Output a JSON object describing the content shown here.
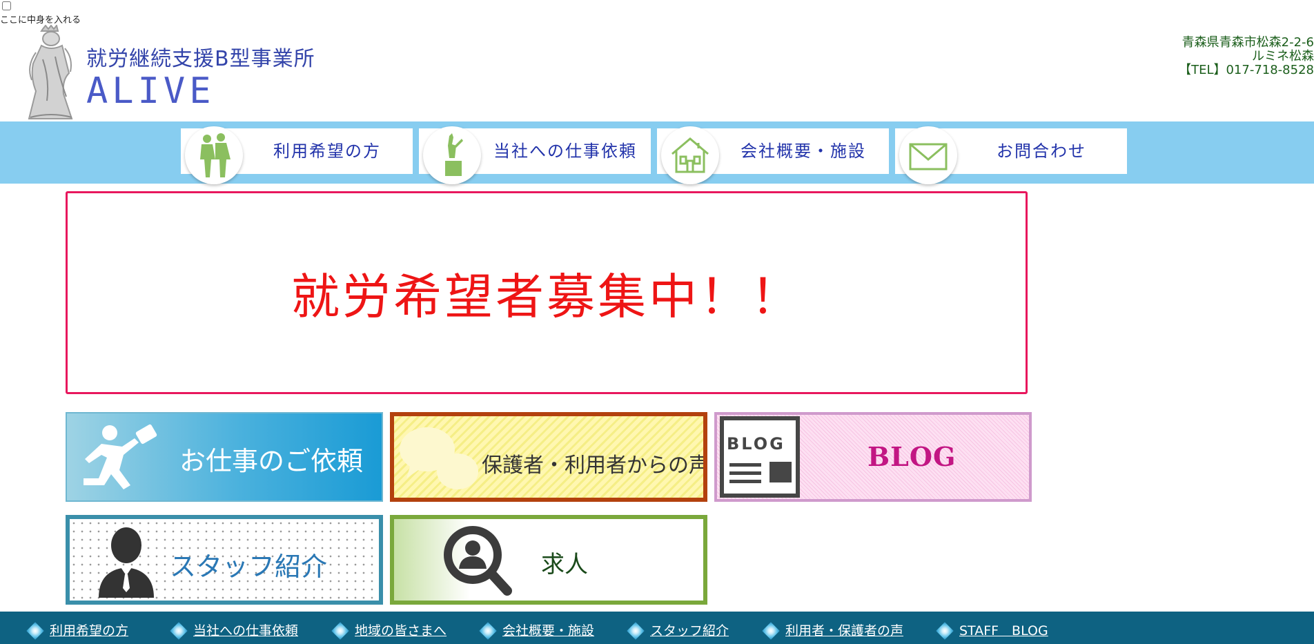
{
  "top": {
    "note": "ここに中身を入れる"
  },
  "site": {
    "subtitle": "就労継続支援B型事業所",
    "name": "ALIVE"
  },
  "address": {
    "line1": "青森県青森市松森2-2-6",
    "line2": "ルミネ松森",
    "tel": "【TEL】017-718-8528"
  },
  "nav": [
    {
      "label": "利用希望の方",
      "icon": "people-icon"
    },
    {
      "label": "当社への仕事依頼",
      "icon": "statue-icon"
    },
    {
      "label": "会社概要・施設",
      "icon": "house-icon"
    },
    {
      "label": "お問合わせ",
      "icon": "envelope-icon"
    }
  ],
  "banner": {
    "text": "就労希望者募集中！！"
  },
  "tiles": {
    "work": "お仕事のご依頼",
    "voice": "保護者・利用者からの声",
    "blog": "BLOG",
    "blog_icon_text": "BLOG",
    "staff": "スタッフ紹介",
    "job": "求人"
  },
  "footer": [
    "利用希望の方",
    "当社への仕事依頼",
    "地域の皆さまへ",
    "会社概要・施設",
    "スタッフ紹介",
    "利用者・保護者の声",
    "STAFF　BLOG"
  ],
  "colors": {
    "nav_band": "#87cdf0",
    "banner_border": "#e8175d",
    "banner_text": "#ee1515",
    "footer_bg": "#0e6282"
  }
}
